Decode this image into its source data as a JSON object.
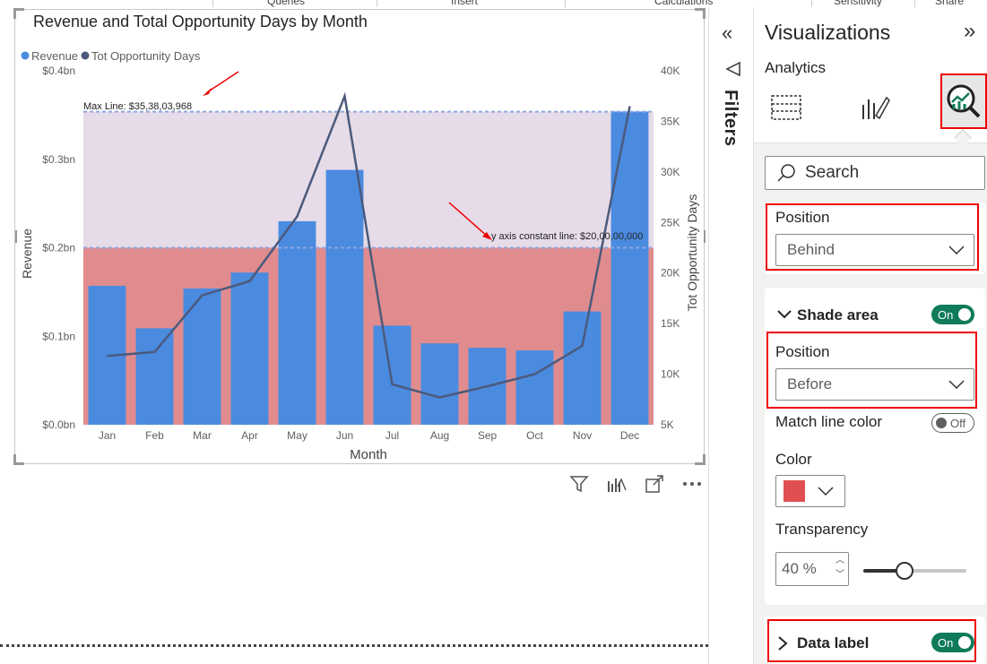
{
  "ribbon": {
    "tabs": [
      "Queries",
      "Insert",
      "Calculations",
      "Sensitivity",
      "Share"
    ]
  },
  "visual": {
    "title": "Revenue and Total Opportunity Days by Month",
    "toolbar_icons": [
      "filter-icon",
      "focus-analytics-icon",
      "expand-icon",
      "more-options-icon"
    ],
    "annotations": {
      "max_line": "Max Line: $35,38,03,968",
      "constant_line": "y axis constant line: $20,00,00,000"
    }
  },
  "chart_data": {
    "type": "bar",
    "title": "Revenue and Total Opportunity Days by Month",
    "xlabel": "Month",
    "ylabel": "Revenue",
    "y2label": "Tot Opportunity Days",
    "categories": [
      "Jan",
      "Feb",
      "Mar",
      "Apr",
      "May",
      "Jun",
      "Jul",
      "Aug",
      "Sep",
      "Oct",
      "Nov",
      "Dec"
    ],
    "series": [
      {
        "name": "Revenue",
        "type": "bar",
        "axis": "left",
        "color": "#4a8be0",
        "values": [
          0.157,
          0.109,
          0.154,
          0.172,
          0.23,
          0.288,
          0.112,
          0.092,
          0.087,
          0.084,
          0.128,
          0.354
        ]
      },
      {
        "name": "Tot Opportunity Days",
        "type": "line",
        "axis": "right",
        "color": "#4b5a7c",
        "values": [
          11800,
          12200,
          17800,
          19200,
          25600,
          37500,
          9000,
          7700,
          8800,
          10000,
          12800,
          36500
        ]
      }
    ],
    "y_ticks": [
      "$0.0bn",
      "$0.1bn",
      "$0.2bn",
      "$0.3bn",
      "$0.4bn"
    ],
    "y2_ticks": [
      "5K",
      "10K",
      "15K",
      "20K",
      "25K",
      "30K",
      "35K",
      "40K"
    ],
    "ylim": [
      0,
      0.4
    ],
    "y2lim": [
      5000,
      40000
    ],
    "reference_lines": [
      {
        "label": "Max Line: $35,38,03,968",
        "value": 0.3538
      },
      {
        "label": "y axis constant line: $20,00,00,000",
        "value": 0.2
      }
    ],
    "shade_colors": {
      "upper": "#e6dbe8",
      "lower": "#e08c8e"
    },
    "legend_position": "top-left",
    "grid": false
  },
  "filters": {
    "label": "Filters"
  },
  "viz_pane": {
    "title": "Visualizations",
    "subtitle": "Analytics",
    "tabs": [
      "build-visual-icon",
      "format-visual-icon",
      "analytics-icon"
    ],
    "search_placeholder": "Search",
    "position_label_1": "Position",
    "position_value_1": "Behind",
    "shade_area_label": "Shade area",
    "shade_area_toggle": "On",
    "position_label_2": "Position",
    "position_value_2": "Before",
    "match_line_color_label": "Match line color",
    "match_line_color_toggle": "Off",
    "color_label": "Color",
    "color_value": "#e05050",
    "transparency_label": "Transparency",
    "transparency_value": "40 %",
    "transparency_fraction": 0.4,
    "data_label_label": "Data label",
    "data_label_toggle": "On"
  }
}
